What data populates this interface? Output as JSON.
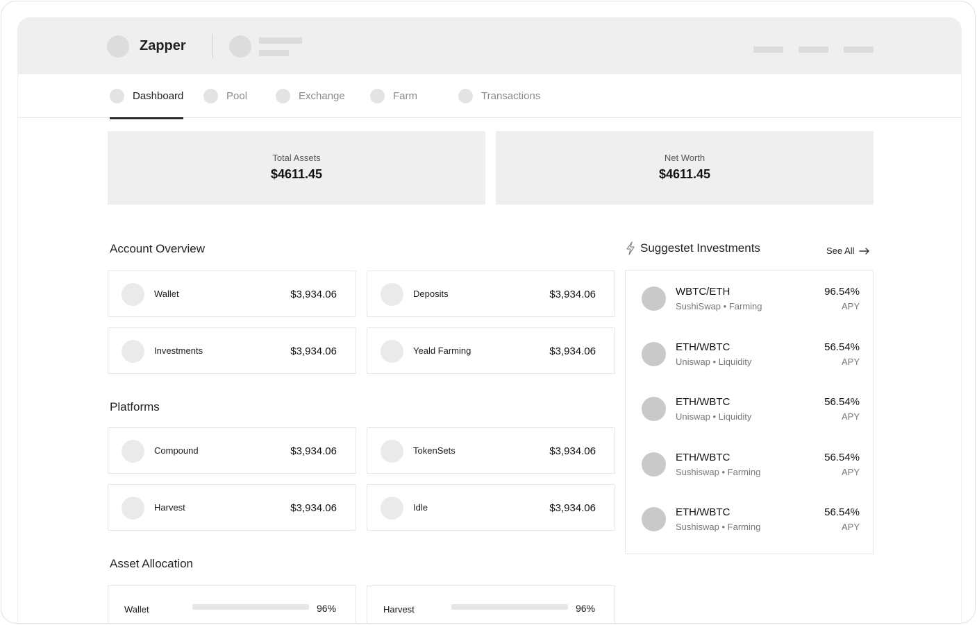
{
  "header": {
    "brand": "Zapper"
  },
  "tabs": [
    {
      "label": "Dashboard",
      "active": true
    },
    {
      "label": "Pool",
      "active": false
    },
    {
      "label": "Exchange",
      "active": false
    },
    {
      "label": "Farm",
      "active": false
    },
    {
      "label": "Transactions",
      "active": false
    }
  ],
  "summary": [
    {
      "label": "Total Assets",
      "value": "$4611.45"
    },
    {
      "label": "Net Worth",
      "value": "$4611.45"
    }
  ],
  "account_overview": {
    "title": "Account Overview",
    "items": [
      {
        "label": "Wallet",
        "value": "$3,934.06"
      },
      {
        "label": "Deposits",
        "value": "$3,934.06"
      },
      {
        "label": "Investments",
        "value": "$3,934.06"
      },
      {
        "label": "Yeald Farming",
        "value": "$3,934.06"
      }
    ]
  },
  "platforms": {
    "title": "Platforms",
    "items": [
      {
        "label": "Compound",
        "value": "$3,934.06"
      },
      {
        "label": "TokenSets",
        "value": "$3,934.06"
      },
      {
        "label": "Harvest",
        "value": "$3,934.06"
      },
      {
        "label": "Idle",
        "value": "$3,934.06"
      }
    ]
  },
  "asset_allocation": {
    "title": "Asset Allocation",
    "items": [
      {
        "label": "Wallet",
        "percent": "96%"
      },
      {
        "label": "Harvest",
        "percent": "96%"
      }
    ]
  },
  "suggested": {
    "title": "Suggestet Investments",
    "see_all": "See All",
    "items": [
      {
        "pair": "WBTC/ETH",
        "subtitle": "SushiSwap • Farming",
        "percent": "96.54%",
        "unit": "APY"
      },
      {
        "pair": "ETH/WBTC",
        "subtitle": "Uniswap • Liquidity",
        "percent": "56.54%",
        "unit": "APY"
      },
      {
        "pair": "ETH/WBTC",
        "subtitle": "Uniswap • Liquidity",
        "percent": "56.54%",
        "unit": "APY"
      },
      {
        "pair": "ETH/WBTC",
        "subtitle": "Sushiswap • Farming",
        "percent": "56.54%",
        "unit": "APY"
      },
      {
        "pair": "ETH/WBTC",
        "subtitle": "Sushiswap • Farming",
        "percent": "56.54%",
        "unit": "APY"
      }
    ]
  }
}
